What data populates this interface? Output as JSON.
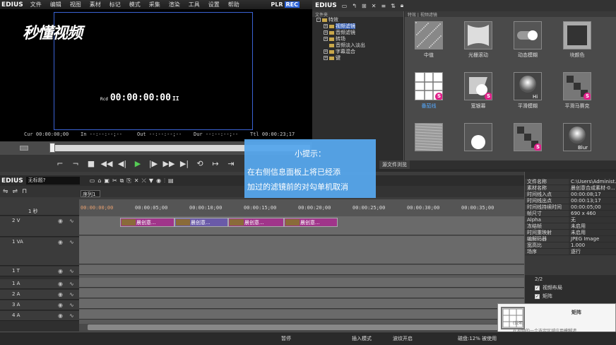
{
  "app": {
    "logo": "EDIUS",
    "plr": "PLR",
    "rec": "REC"
  },
  "menu": [
    "文件",
    "编辑",
    "视图",
    "素材",
    "标记",
    "模式",
    "采集",
    "渲染",
    "工具",
    "设置",
    "帮助"
  ],
  "player": {
    "watermark": "秒懂视频",
    "rec_label": "Rcd",
    "timecode": "00:00:00:00",
    "pause_glyph": "II",
    "cur": "Cur 00:00:00;00",
    "in": "In --:--:--;--",
    "out": "Out --:--:--;--",
    "dur": "Dur --:--:--;--",
    "ttl": "Ttl 00:00:23;17"
  },
  "effects": {
    "tree_header": "文件夹",
    "path_header": "特效 | 视频滤镜",
    "tree": [
      {
        "label": "特效",
        "level": 0,
        "expander": "-"
      },
      {
        "label": "视频滤镜",
        "level": 1,
        "expander": "+",
        "selected": true
      },
      {
        "label": "音频滤镜",
        "level": 1,
        "expander": "+"
      },
      {
        "label": "转场",
        "level": 1,
        "expander": "+"
      },
      {
        "label": "音频淡入淡出",
        "level": 1,
        "expander": ""
      },
      {
        "label": "字幕混合",
        "level": 1,
        "expander": "+"
      },
      {
        "label": "键",
        "level": 1,
        "expander": "+"
      }
    ],
    "items": [
      {
        "label": "中值",
        "icon": "median-icon",
        "s": false
      },
      {
        "label": "光栅滚动",
        "icon": "raster-scroll-icon",
        "s": false
      },
      {
        "label": "动态模糊",
        "icon": "motion-blur-icon",
        "s": false
      },
      {
        "label": "块颜色",
        "icon": "block-color-icon",
        "s": false
      },
      {
        "label": "番茄线",
        "icon": "grid-icon",
        "s": true,
        "selected": true
      },
      {
        "label": "宽银幕",
        "icon": "widescreen-icon",
        "s": true
      },
      {
        "label": "平滑模糊",
        "icon": "smooth-blur-icon",
        "s": false
      },
      {
        "label": "平滑马赛克",
        "icon": "smooth-mosaic-icon",
        "s": true
      },
      {
        "label": "",
        "icon": "texture-icon",
        "s": false
      },
      {
        "label": "",
        "icon": "circle-icon",
        "s": false
      },
      {
        "label": "",
        "icon": "mosaic-icon",
        "s": true
      },
      {
        "label": "",
        "icon": "blur-icon",
        "s": false
      }
    ],
    "tabs": [
      "源文件浏览"
    ]
  },
  "timeline": {
    "logo": "EDIUS",
    "project": "无标题?",
    "sequence_tab": "序列1",
    "scale_label": "1 秒",
    "ruler": [
      "00:00:00;00",
      "00:00:05;00",
      "00:00:10;00",
      "00:00:15;00",
      "00:00:20;00",
      "00:00:25;00",
      "00:00:30;00",
      "00:00:35;00"
    ],
    "tracks": [
      {
        "name": "2 V"
      },
      {
        "name": "1 VA"
      },
      {
        "name": "1 T"
      },
      {
        "name": "1 A"
      },
      {
        "name": "2 A"
      },
      {
        "name": "3 A"
      },
      {
        "name": "4 A"
      }
    ],
    "clips": [
      "晨创意...",
      "晨创意...",
      "晨创意...",
      "晨创意..."
    ]
  },
  "info": {
    "header": "",
    "rows": [
      {
        "k": "文件名称",
        "v": "C:\\Users\\Administ..."
      },
      {
        "k": "素材名称",
        "v": "晨创意合成素材-0..."
      },
      {
        "k": "时间线入点",
        "v": "00:00:08;17"
      },
      {
        "k": "时间线出点",
        "v": "00:00:13;17"
      },
      {
        "k": "时间线持续时间",
        "v": "00:00:05;00"
      },
      {
        "k": "帧尺寸",
        "v": "690 x 460"
      },
      {
        "k": "Alpha",
        "v": "无"
      },
      {
        "k": "冻结帧",
        "v": "未启用"
      },
      {
        "k": "时间重映射",
        "v": "未启用"
      },
      {
        "k": "编解码器",
        "v": "JPEG Image"
      },
      {
        "k": "宽高比",
        "v": "1.000"
      },
      {
        "k": "场序",
        "v": "逐行"
      }
    ],
    "count": "2/2",
    "applied": [
      {
        "label": "视频布局",
        "checked": true
      },
      {
        "label": "矩阵",
        "checked": true
      }
    ]
  },
  "tooltip": {
    "title": "矩阵",
    "label": "(说明)",
    "desc": "在视频的一个选定区域应用模糊滤"
  },
  "hint": {
    "title": "小提示：",
    "line1": "在右侧信息面板上将已经添",
    "line2": "加过的滤镜前的对勾单机取消"
  },
  "status": {
    "pause": "暂停",
    "insert": "插入模式",
    "ripple": "波纹开启",
    "disk": "磁盘:12% 被使用"
  },
  "colors": {
    "accent": "#3b63d4",
    "hint_bg": "#56a6ec",
    "s_badge": "#e0208a",
    "ruler_tc": "#e8a070"
  }
}
